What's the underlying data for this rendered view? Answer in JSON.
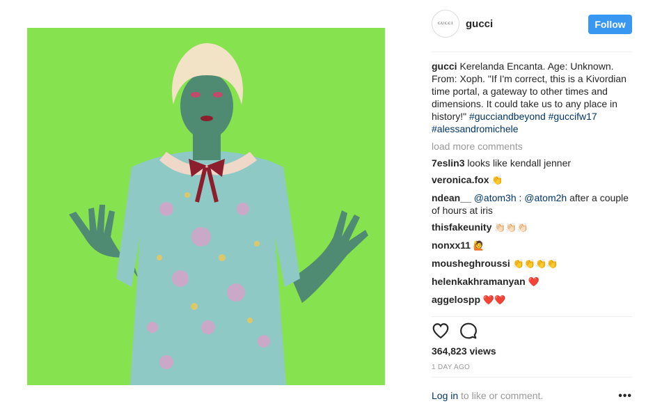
{
  "post": {
    "media_alt_icon": "green-screen-figure-photo",
    "colors": {
      "background": "#86e24f",
      "skin": "#4f8a73",
      "dress": "#8fc9c5",
      "bow": "#8c1e2d"
    }
  },
  "header": {
    "avatar_text": "GUCCI",
    "username": "gucci",
    "follow_label": "Follow"
  },
  "caption": {
    "username": "gucci",
    "text": "Kerelanda Encanta. Age: Unknown. From: Xoph. \"If I'm correct, this is a Kivordian time portal, a gateway to other times and dimensions. It could take us to any place in history!\"",
    "hashtags": [
      "#gucciandbeyond",
      "#guccifw17",
      "#alessandromichele"
    ]
  },
  "load_more": "load more comments",
  "comments": [
    {
      "user": "7eslin3",
      "text": "looks like kendall jenner"
    },
    {
      "user": "veronica.fox",
      "text": "👏"
    },
    {
      "user": "ndean__",
      "mention1": "@atom3h",
      "sep": " : ",
      "mention2": "@atom2h",
      "text": " after a couple of hours at iris"
    },
    {
      "user": "thisfakeunity",
      "text": "👏🏻👏🏻👏🏻"
    },
    {
      "user": "nonxx11",
      "text": "🙋"
    },
    {
      "user": "mousheghroussi",
      "text": "👏👏👏👏"
    },
    {
      "user": "helenkakhramanyan",
      "text": "❤️"
    },
    {
      "user": "aggelospp",
      "text": "❤️❤️"
    }
  ],
  "actions": {
    "like_icon": "heart-icon",
    "comment_icon": "comment-icon"
  },
  "views": "364,823 views",
  "time": "1 DAY AGO",
  "footer": {
    "login": "Log in",
    "rest": " to like or comment.",
    "more": "•••"
  }
}
